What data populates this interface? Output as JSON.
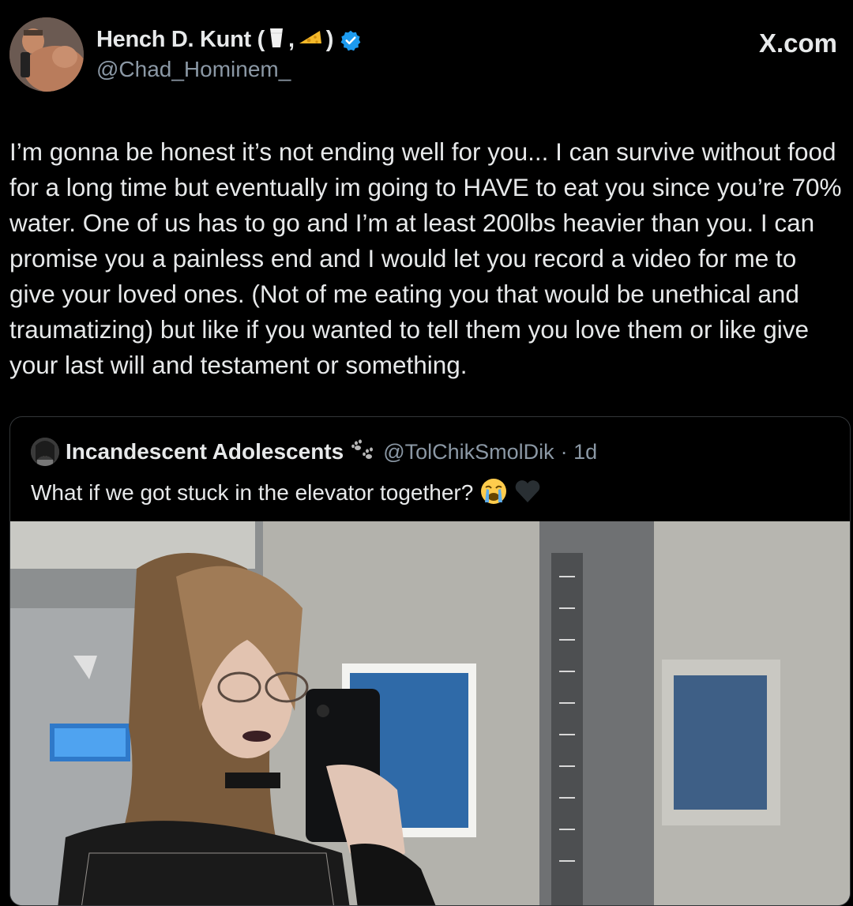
{
  "author": {
    "display_name": "Hench D. Kunt (",
    "name_separator": ",",
    "name_close": ")",
    "handle": "@Chad_Hominem_",
    "verified": true,
    "badge_icons": [
      "milk-glass-icon",
      "cheese-icon"
    ]
  },
  "site_label": "X.com",
  "tweet": {
    "text": "I’m gonna be honest it’s not ending well for you... I can survive without food for a long time but eventually im going to HAVE to eat you since you’re 70% water. One of us has to go and I’m at least 200lbs heavier than you. I can promise you a painless end and I would let you record a video for me to give your loved ones. (Not of me eating you that would be unethical and traumatizing) but like if you wanted to tell them you love them or like give your last will and testament or something."
  },
  "quoted_tweet": {
    "display_name": "Incandescent Adolescents",
    "handle": "@TolChikSmolDik",
    "time": "· 1d",
    "text": "What if we got stuck in the elevator together?",
    "emojis": [
      "loudly-crying-face-icon",
      "black-heart-icon"
    ],
    "name_emoji": "paw-prints-icon"
  },
  "colors": {
    "background": "#000000",
    "text": "#e7e9ea",
    "secondary_text": "#8b98a5",
    "verified_blue": "#1d9bf0",
    "border": "#333639"
  }
}
